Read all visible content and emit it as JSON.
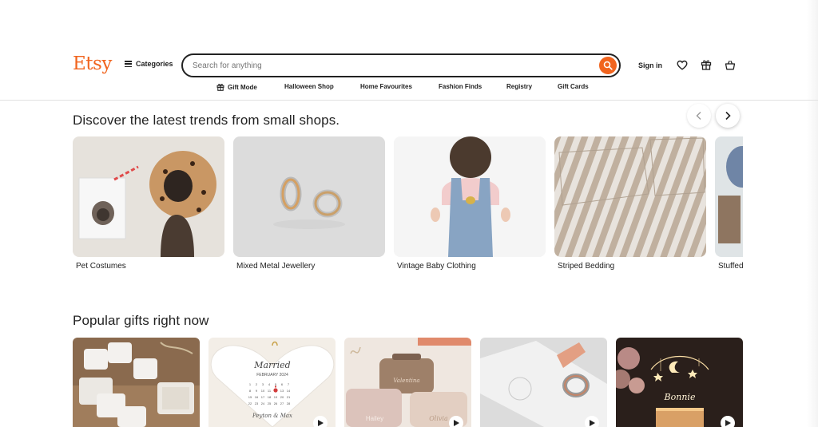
{
  "header": {
    "logo": "Etsy",
    "categories_label": "Categories",
    "search": {
      "placeholder": "Search for anything",
      "value": ""
    },
    "signin_label": "Sign in",
    "accent_color": "#f1641e"
  },
  "subnav": [
    {
      "label": "Gift Mode",
      "icon": "gift-icon"
    },
    {
      "label": "Halloween Shop"
    },
    {
      "label": "Home Favourites"
    },
    {
      "label": "Fashion Finds"
    },
    {
      "label": "Registry"
    },
    {
      "label": "Gift Cards"
    }
  ],
  "trends": {
    "title": "Discover the latest trends from small shops.",
    "items": [
      {
        "label": "Pet Costumes"
      },
      {
        "label": "Mixed Metal Jewellery"
      },
      {
        "label": "Vintage Baby Clothing"
      },
      {
        "label": "Striped Bedding"
      },
      {
        "label": "Stuffed"
      }
    ]
  },
  "gifts": {
    "title": "Popular gifts right now",
    "items": [
      {
        "name": "jewellery-boxes"
      },
      {
        "name": "wedding-calendar-ornament",
        "heading": "Married",
        "month": "FEBRUARY 2024",
        "names": "Peyton & Max"
      },
      {
        "name": "personalised-makeup-bags",
        "tags": [
          "Valentina",
          "Hailey",
          "Olivia"
        ]
      },
      {
        "name": "ring-box"
      },
      {
        "name": "name-night-light",
        "text": "Bonnie"
      }
    ]
  }
}
